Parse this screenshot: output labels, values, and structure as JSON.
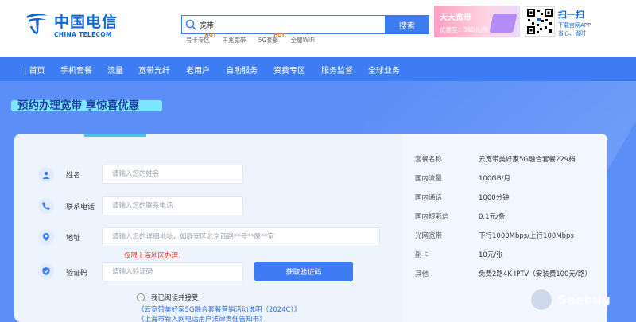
{
  "brand": {
    "name_cn": "中国电信",
    "name_en": "CHINA TELECOM",
    "color": "#1167d8"
  },
  "search": {
    "value": "宽带",
    "button_label": "搜索",
    "icon": "search-icon"
  },
  "hot_words": [
    {
      "label": "号卡专区",
      "hot": "HOT"
    },
    {
      "label": "千兆宽带",
      "hot": ""
    },
    {
      "label": "5G套餐",
      "hot": "HOT"
    },
    {
      "label": "全屋WiFi",
      "hot": ""
    }
  ],
  "ad": {
    "title": "天天宽带",
    "subtitle": "优惠至：360元/年"
  },
  "app_promo": {
    "title": "扫一扫",
    "line1": "下载官网APP",
    "line2": "省心、省时"
  },
  "nav": [
    "首页",
    "手机套餐",
    "流量",
    "宽带光纤",
    "老用户",
    "自助服务",
    "资费专区",
    "服务监督",
    "全球业务"
  ],
  "promo_title": "预约办理宽带 享惊喜优惠",
  "form": {
    "name": {
      "label": "姓名",
      "placeholder": "请输入您的姓名",
      "icon": "user-icon"
    },
    "phone": {
      "label": "联系电话",
      "placeholder": "请输入您的联系电话",
      "icon": "phone-icon"
    },
    "address": {
      "label": "地址",
      "placeholder": "请输入您的详细地址，如静安区北京西路**号**层**室",
      "icon": "location-pin-icon",
      "warning": "仅限上海地区办理；"
    },
    "code": {
      "label": "验证码",
      "placeholder": "请输入验证码",
      "icon": "shield-check-icon",
      "button_label": "获取验证码"
    },
    "agree": {
      "text": "我已阅读并接受",
      "links": [
        "《云宽带美好家5G融合套餐营销活动说明（2024C）》",
        "《上海市新入网电话用户法律责任告知书》"
      ]
    }
  },
  "plan_info": [
    {
      "key": "套餐名称",
      "value": "云宽带美好家5G融合套餐229档"
    },
    {
      "key": "国内流量",
      "value": "100GB/月"
    },
    {
      "key": "国内通话",
      "value": "1000分钟"
    },
    {
      "key": "国内短彩信",
      "value": "0.1元/条"
    },
    {
      "key": "光网宽带",
      "value": "下行1000Mbps/上行100Mbps"
    },
    {
      "key": "副卡",
      "value": "10元/张"
    },
    {
      "key": "其他",
      "value": "免费2路4K IPTV（安装费100元/路）"
    }
  ],
  "watermark": "Seebug",
  "colors": {
    "primary": "#3d7cf2",
    "hero": "#5b8ff7",
    "warning": "#e53b2b",
    "link": "#2f6bdc"
  }
}
